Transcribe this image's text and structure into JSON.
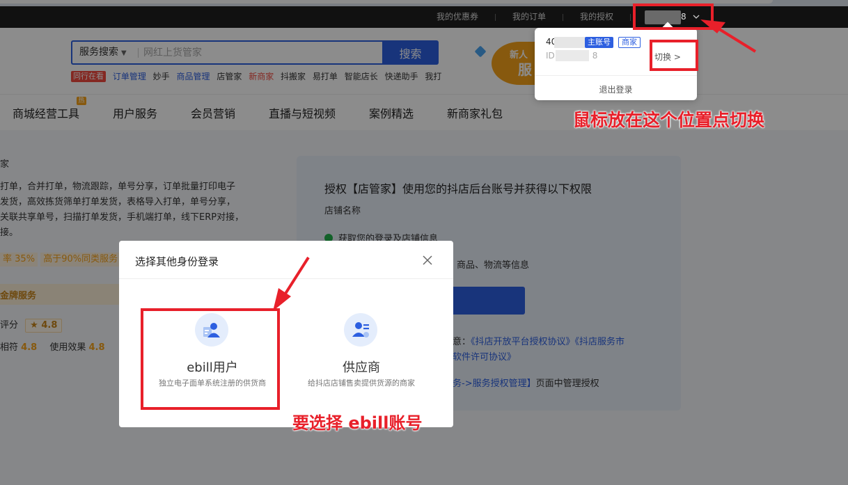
{
  "topbar": {
    "links": [
      "我的优惠券",
      "我的订单",
      "我的授权"
    ],
    "account_tail": "8"
  },
  "search": {
    "type_label": "服务搜索",
    "placeholder": "网红上货管家",
    "button_label": "搜索"
  },
  "hot_tags": {
    "badge": "同行在看",
    "items": [
      {
        "label": "订单管理",
        "style": "blue"
      },
      {
        "label": "妙手",
        "style": "normal"
      },
      {
        "label": "商品管理",
        "style": "blue"
      },
      {
        "label": "店管家",
        "style": "normal"
      },
      {
        "label": "新商家",
        "style": "red"
      },
      {
        "label": "抖搬家",
        "style": "normal"
      },
      {
        "label": "易打单",
        "style": "normal"
      },
      {
        "label": "智能店长",
        "style": "normal"
      },
      {
        "label": "快递助手",
        "style": "normal"
      },
      {
        "label": "我打",
        "style": "normal"
      }
    ]
  },
  "promo": {
    "line1": "新人",
    "line2": "服"
  },
  "nav": {
    "hot_badge": "热",
    "items": [
      "商城经营工具",
      "用户服务",
      "会员营销",
      "直播与短视频",
      "案例精选",
      "新商家礼包"
    ]
  },
  "left_panel": {
    "title_tail": "家",
    "lines": [
      "打单，合并打单，物流跟踪，单号分享，订单批量打印电子",
      "发货，高效拣货筛单打单发货，表格导入打单，单号分享，",
      "关联共享单号，扫描打单发货，手机端打单，线下ERP对接，",
      "接。"
    ],
    "rate_prefix": "率",
    "rate_value": "35%",
    "rate_note": "高于90%同类服务",
    "gold_label": "金牌服务",
    "score_label": "评分",
    "score_value": "★ 4.8",
    "match_label": "相符",
    "match_value": "4.8",
    "effect_label": "使用效果",
    "effect_value": "4.8"
  },
  "auth_card": {
    "title": "授权【店管家】使用您的抖店后台账号并获得以下权限",
    "shop_label": "店铺名称",
    "perm1": "获取您的登录及店铺信息",
    "perm2_tail": "商品、物流等信息",
    "agree_prefix": "意：",
    "agree_link1": "《抖店开放平台授权协议》《抖店服务市",
    "agree_link2": "软件许可协议》",
    "manage_prefix": "务->服务授权管理】",
    "manage_suffix": "页面中管理授权"
  },
  "dropdown": {
    "name_prefix": "40",
    "tag_main": "主账号",
    "tag_merchant": "商家",
    "id_prefix": "ID",
    "id_tail": "8",
    "switch_label": "切换 >",
    "logout_label": "退出登录"
  },
  "modal": {
    "title": "选择其他身份登录",
    "options": [
      {
        "name": "ebill用户",
        "desc": "独立电子面单系统注册的供货商"
      },
      {
        "name": "供应商",
        "desc": "给抖店店铺售卖提供货源的商家"
      }
    ]
  },
  "annotations": {
    "switch_hint": "鼠标放在这个位置点切换",
    "ebill_hint": "要选择 ebill账号",
    "color": "#e8202a"
  },
  "colors": {
    "brand_blue": "#2d5fe0",
    "topbar_bg": "#1f1f1f",
    "accent_orange": "#f6a21a"
  }
}
